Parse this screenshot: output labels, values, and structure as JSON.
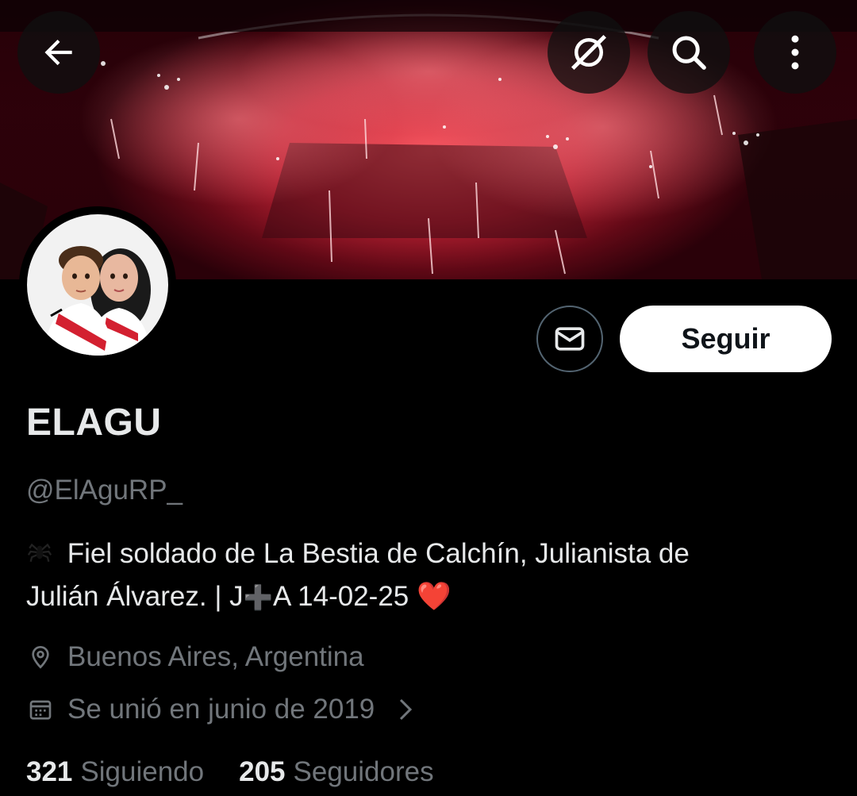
{
  "profile": {
    "display_name": "ELAGU",
    "handle": "@ElAguRP_",
    "bio": {
      "part1": "Fiel soldado de La Bestia de Calchín, Julianista de",
      "part2": "Julián Álvarez. | J",
      "plus": "➕",
      "part3": "A 14-02-25",
      "heart": "❤️"
    },
    "location": "Buenos Aires, Argentina",
    "joined": "Se unió en junio de 2019"
  },
  "stats": {
    "following_count": "321",
    "following_label": "Siguiendo",
    "followers_count": "205",
    "followers_label": "Seguidores"
  },
  "actions": {
    "follow_label": "Seguir"
  },
  "icons": {
    "back": "arrow-left-icon",
    "grok": "grok-icon",
    "search": "search-icon",
    "more": "more-vertical-icon",
    "message": "envelope-icon",
    "location": "location-pin-icon",
    "calendar": "calendar-icon",
    "chevron": "chevron-right-icon"
  },
  "colors": {
    "background": "#000000",
    "primary_text": "#e7e9ea",
    "secondary_text": "#71767b",
    "follow_button_bg": "#ffffff",
    "border": "#536471"
  }
}
